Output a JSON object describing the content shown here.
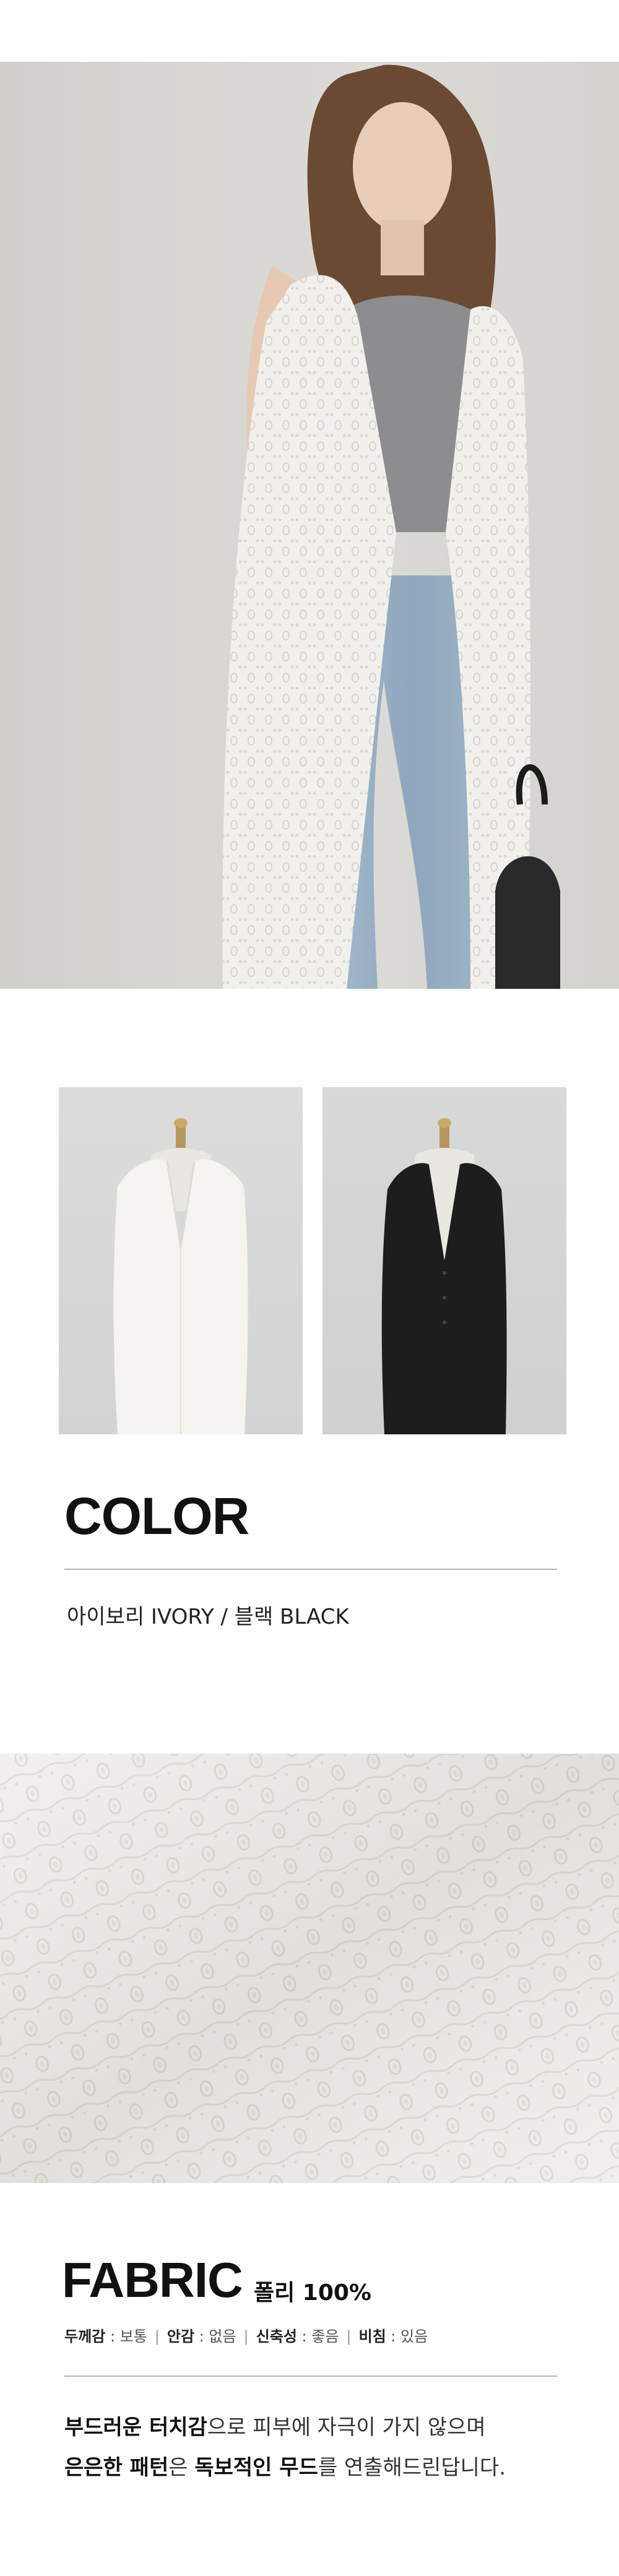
{
  "images": {
    "hero": "model-wearing-ivory-long-vest-photo",
    "swatch_ivory": "ivory-vest-on-mannequin-photo",
    "swatch_black": "black-vest-on-mannequin-photo",
    "fabric": "ivory-eyelet-knit-fabric-closeup-photo"
  },
  "color_section": {
    "title": "COLOR",
    "options": "아이보리 IVORY / 블랙 BLACK"
  },
  "fabric_section": {
    "title": "FABRIC",
    "material": "폴리 100%",
    "specs": [
      {
        "label": "두께감",
        "value": "보통"
      },
      {
        "label": "안감",
        "value": "없음"
      },
      {
        "label": "신축성",
        "value": "좋음"
      },
      {
        "label": "비침",
        "value": "있음"
      }
    ],
    "desc_line1": {
      "bold1": "부드러운 터치감",
      "rest1": "으로 피부에 자극이 가지 않으며"
    },
    "desc_line2": {
      "bold1": "은은한 패턴",
      "mid1": "은 ",
      "bold2": "독보적인 무드",
      "rest2": "를 연출해드린답니다."
    }
  },
  "colors": {
    "ivory": "#f3f2ee",
    "black": "#1c1b1b",
    "denim": "#9db3c6",
    "title": "#111111",
    "divider": "#b5b5b5"
  }
}
